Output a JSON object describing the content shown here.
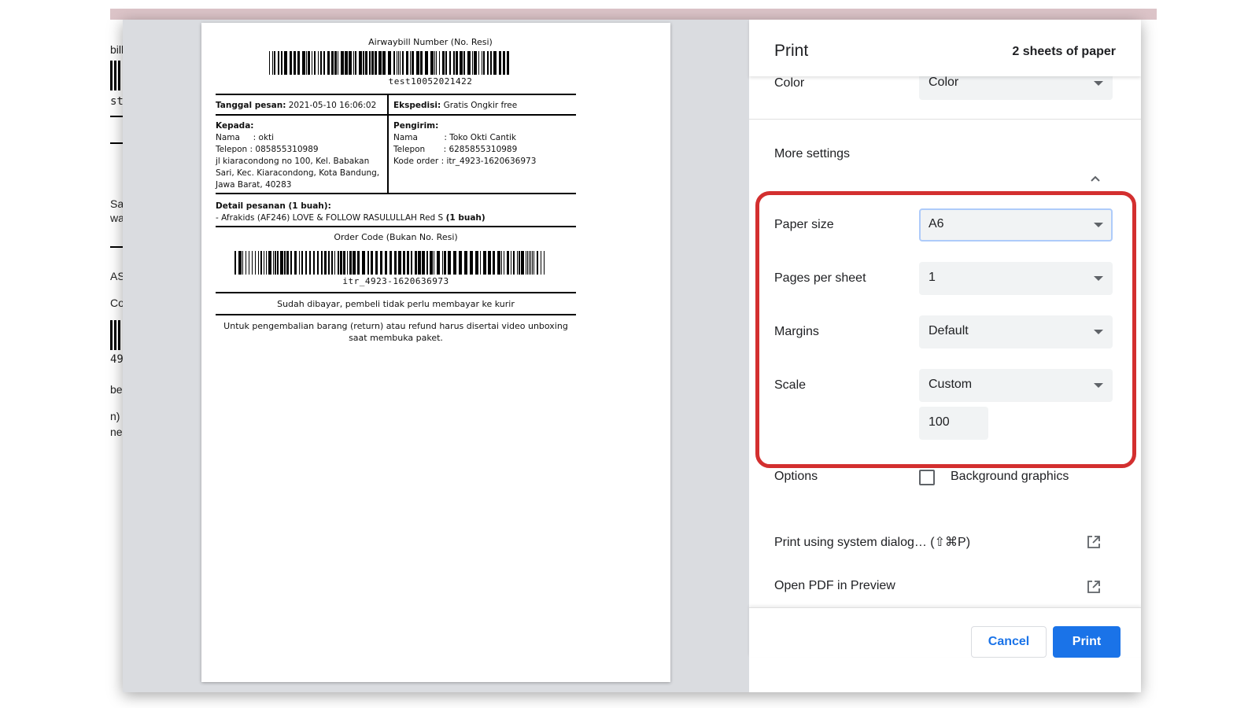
{
  "background_page": {
    "fragments": [
      "bill",
      "st",
      "Sa",
      "wa",
      "AS",
      "Co",
      "49",
      "be",
      "n)",
      "nei"
    ]
  },
  "label": {
    "awb_title": "Airwaybill Number (No. Resi)",
    "awb_number": "test10052021422",
    "order_date_label": "Tanggal pesan:",
    "order_date_value": "2021-05-10 16:06:02",
    "expedition_label": "Ekspedisi:",
    "expedition_value": "Gratis Ongkir free",
    "recipient": {
      "heading": "Kepada:",
      "name_line": "Nama     : okti",
      "phone_line": "Telepon : 085855310989",
      "address": "jl kiaracondong no 100, Kel. Babakan Sari, Kec. Kiaracondong, Kota Bandung, Jawa Barat, 40283"
    },
    "sender": {
      "heading": "Pengirim:",
      "name_line": "Nama          : Toko Okti Cantik",
      "phone_line": "Telepon       : 6285855310989",
      "order_line": "Kode order : itr_4923-1620636973"
    },
    "detail_heading": "Detail pesanan (1 buah):",
    "detail_item": "- Afrakids (AF246) LOVE & FOLLOW RASULULLAH Red S",
    "detail_qty": "(1 buah)",
    "order_code_title": "Order Code (Bukan No. Resi)",
    "order_code": "itr_4923-1620636973",
    "paid_note": "Sudah dibayar, pembeli tidak perlu membayar ke kurir",
    "return_note": "Untuk pengembalian barang (return) atau refund harus disertai video unboxing saat membuka paket."
  },
  "settings": {
    "title": "Print",
    "sheets": "2 sheets of paper",
    "color_label": "Color",
    "color_value": "Color",
    "more_settings_label": "More settings",
    "paper_size_label": "Paper size",
    "paper_size_value": "A6",
    "pages_per_sheet_label": "Pages per sheet",
    "pages_per_sheet_value": "1",
    "margins_label": "Margins",
    "margins_value": "Default",
    "scale_label": "Scale",
    "scale_value": "Custom",
    "scale_custom_value": "100",
    "options_label": "Options",
    "background_graphics_label": "Background graphics",
    "system_dialog_label": "Print using system dialog… (⇧⌘P)",
    "open_pdf_label": "Open PDF in Preview",
    "cancel_label": "Cancel",
    "print_label": "Print"
  },
  "colors": {
    "accent": "#1a73e8",
    "highlight": "#d32f2f",
    "preview_bg": "#dadce0",
    "top_strip": "#dcc4c8"
  }
}
